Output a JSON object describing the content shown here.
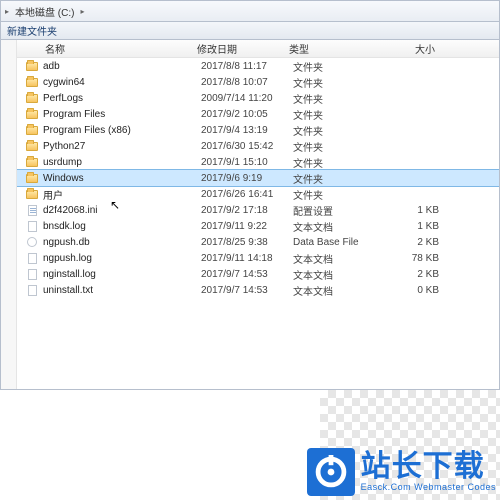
{
  "addressbar": {
    "root_arrow": "▸",
    "drive": "本地磁盘 (C:)",
    "sep": "▸"
  },
  "toolbar": {
    "newfolder": "新建文件夹"
  },
  "columns": {
    "name": "名称",
    "date": "修改日期",
    "type": "类型",
    "size": "大小"
  },
  "rows": [
    {
      "icon": "folder",
      "name": "adb",
      "date": "2017/8/8 11:17",
      "type": "文件夹",
      "size": ""
    },
    {
      "icon": "folder",
      "name": "cygwin64",
      "date": "2017/8/8 10:07",
      "type": "文件夹",
      "size": ""
    },
    {
      "icon": "folder",
      "name": "PerfLogs",
      "date": "2009/7/14 11:20",
      "type": "文件夹",
      "size": ""
    },
    {
      "icon": "folder",
      "name": "Program Files",
      "date": "2017/9/2 10:05",
      "type": "文件夹",
      "size": ""
    },
    {
      "icon": "folder",
      "name": "Program Files (x86)",
      "date": "2017/9/4 13:19",
      "type": "文件夹",
      "size": ""
    },
    {
      "icon": "folder",
      "name": "Python27",
      "date": "2017/6/30 15:42",
      "type": "文件夹",
      "size": ""
    },
    {
      "icon": "folder",
      "name": "usrdump",
      "date": "2017/9/1 15:10",
      "type": "文件夹",
      "size": ""
    },
    {
      "icon": "folder",
      "name": "Windows",
      "date": "2017/9/6 9:19",
      "type": "文件夹",
      "size": "",
      "selected": true
    },
    {
      "icon": "folder",
      "name": "用户",
      "date": "2017/6/26 16:41",
      "type": "文件夹",
      "size": ""
    },
    {
      "icon": "ini",
      "name": "d2f42068.ini",
      "date": "2017/9/2 17:18",
      "type": "配置设置",
      "size": "1 KB"
    },
    {
      "icon": "file",
      "name": "bnsdk.log",
      "date": "2017/9/11 9:22",
      "type": "文本文档",
      "size": "1 KB"
    },
    {
      "icon": "db",
      "name": "ngpush.db",
      "date": "2017/8/25 9:38",
      "type": "Data Base File",
      "size": "2 KB"
    },
    {
      "icon": "file",
      "name": "ngpush.log",
      "date": "2017/9/11 14:18",
      "type": "文本文档",
      "size": "78 KB"
    },
    {
      "icon": "file",
      "name": "nginstall.log",
      "date": "2017/9/7 14:53",
      "type": "文本文档",
      "size": "2 KB"
    },
    {
      "icon": "file",
      "name": "uninstall.txt",
      "date": "2017/9/7 14:53",
      "type": "文本文档",
      "size": "0 KB"
    }
  ],
  "watermark": {
    "cn": "站长下载",
    "en": "Easck.Com Webmaster Codes"
  }
}
